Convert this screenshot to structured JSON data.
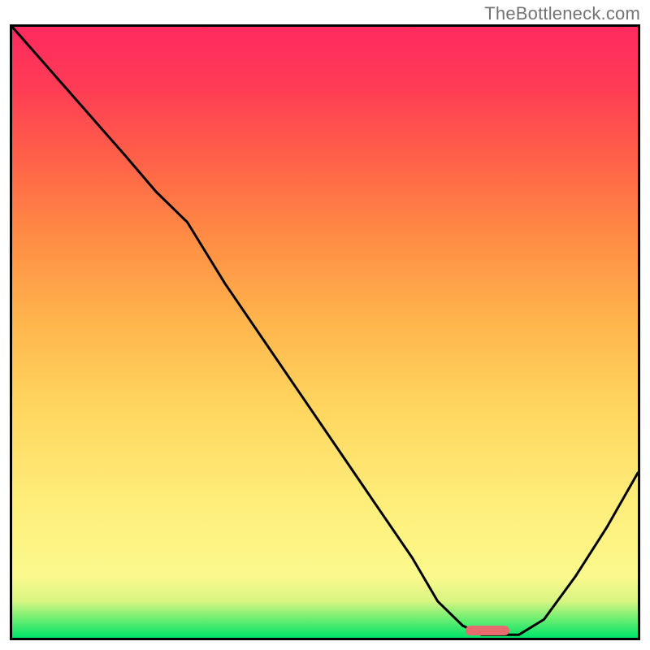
{
  "watermark": "TheBottleneck.com",
  "chart_data": {
    "type": "line",
    "title": "",
    "xlabel": "",
    "ylabel": "",
    "xlim": [
      0,
      100
    ],
    "ylim": [
      0,
      100
    ],
    "grid": false,
    "series": [
      {
        "name": "bottleneck-curve",
        "x": [
          0,
          6,
          12,
          18,
          23,
          28,
          34,
          40,
          46,
          52,
          58,
          64,
          68,
          72,
          75,
          78,
          81,
          85,
          90,
          95,
          100
        ],
        "y": [
          100,
          93,
          86,
          79,
          73,
          68,
          58,
          49,
          40,
          31,
          22,
          13,
          6,
          2,
          0.5,
          0.5,
          0.5,
          3,
          10,
          18,
          27
        ]
      }
    ],
    "annotations": [
      {
        "name": "optimal-marker",
        "x": 76,
        "y": 1.2,
        "width_pct": 7,
        "height_pct": 1.5,
        "color": "#e76a6f"
      }
    ],
    "background": "gradient-heatmap-green-to-red"
  }
}
